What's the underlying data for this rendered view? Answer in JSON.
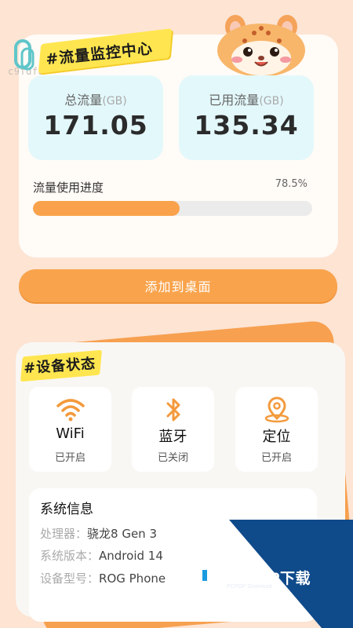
{
  "header": {
    "watermark": "c9fdf8",
    "title": "#流量监控中心"
  },
  "traffic": {
    "total_label": "总流量",
    "used_label": "已用流量",
    "unit": "(GB)",
    "total_value": "171.05",
    "used_value": "135.34",
    "progress_label": "流量使用进度",
    "progress_percent_text": "78.5%",
    "progress_fraction": 0.525
  },
  "actions": {
    "add_to_desktop_label": "添加到桌面"
  },
  "device": {
    "title": "#设备状态",
    "tiles": [
      {
        "name": "WiFi",
        "state": "已开启",
        "icon": "wifi-icon"
      },
      {
        "name": "蓝牙",
        "state": "已关闭",
        "icon": "bluetooth-icon"
      },
      {
        "name": "定位",
        "state": "已开启",
        "icon": "location-icon"
      }
    ],
    "system_info": {
      "title": "系统信息",
      "rows": [
        {
          "key": "处理器：",
          "value": "骁龙8 Gen 3"
        },
        {
          "key": "系统版本：",
          "value": "Android 14"
        },
        {
          "key": "设备型号：",
          "value": "ROG Phone"
        }
      ]
    }
  },
  "overlay": {
    "brand": "PCPOP下载",
    "sub": "PCPOP Download"
  },
  "colors": {
    "background": "#fde4d3",
    "accent_orange": "#f9a24b",
    "stat_box": "#e3f8fb",
    "title_yellow": "#ffe650",
    "overlay_blue": "#0f4a8a"
  }
}
